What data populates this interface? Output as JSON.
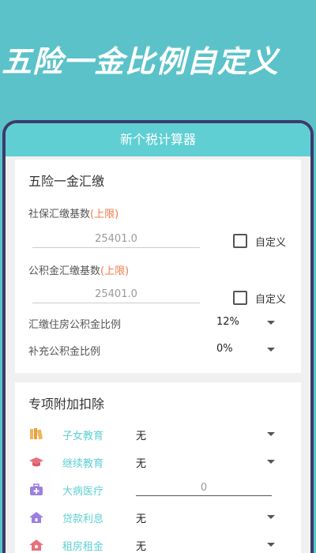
{
  "promo": {
    "title": "五险一金比例自定义"
  },
  "app_bar": {
    "title": "新个税计算器"
  },
  "insurance": {
    "title": "五险一金汇缴",
    "social_base": {
      "label": "社保汇缴基数",
      "limit": "(上限)",
      "value": "25401.0",
      "custom_label": "自定义"
    },
    "fund_base": {
      "label": "公积金汇缴基数",
      "limit": "(上限)",
      "value": "25401.0",
      "custom_label": "自定义"
    },
    "fund_ratio": {
      "label": "汇缴住房公积金比例",
      "value": "12%"
    },
    "extra_ratio": {
      "label": "补充公积金比例",
      "value": "0%"
    }
  },
  "deductions": {
    "title": "专项附加扣除",
    "items": [
      {
        "label": "子女教育",
        "value": "无",
        "icon": "books-icon",
        "color": "#f0b45a"
      },
      {
        "label": "继续教育",
        "value": "无",
        "icon": "graduation-cap-icon",
        "color": "#e8707a"
      },
      {
        "label": "大病医疗",
        "value": "0",
        "icon": "medical-kit-icon",
        "color": "#9b7fe0"
      },
      {
        "label": "贷款利息",
        "value": "无",
        "icon": "house-icon",
        "color": "#9b7fe0"
      },
      {
        "label": "租房租金",
        "value": "无",
        "icon": "rent-house-icon",
        "color": "#e8707a"
      }
    ]
  },
  "colors": {
    "background": "#5bc2c9",
    "accent": "#5fcfd3",
    "limit": "#f07a4a"
  }
}
